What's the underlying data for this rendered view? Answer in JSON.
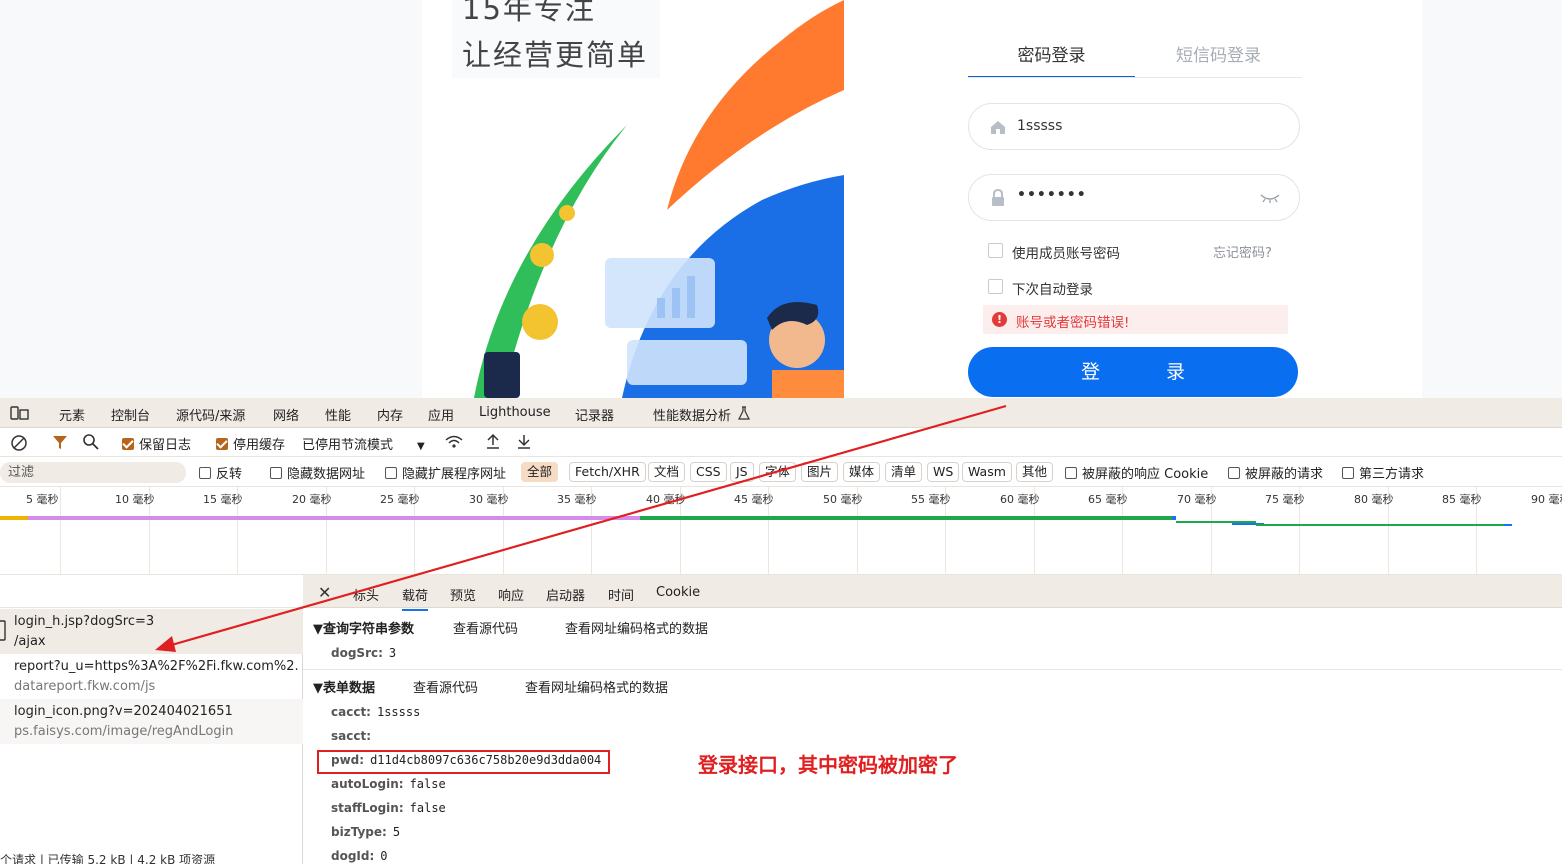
{
  "hero": {
    "line1": "15年专注",
    "line2": "让经营更简单"
  },
  "login": {
    "tabs": [
      "密码登录",
      "短信码登录"
    ],
    "username_value": "1sssss",
    "password_mask": "•••••••",
    "member_checkbox": "使用成员账号密码",
    "forgot": "忘记密码?",
    "auto_login": "下次自动登录",
    "error_icon": "!",
    "error": "账号或者密码错误!",
    "button": "登 录"
  },
  "devtools": {
    "tabs": [
      "元素",
      "控制台",
      "源代码/来源",
      "网络",
      "性能",
      "内存",
      "应用",
      "Lighthouse",
      "记录器",
      "性能数据分析"
    ],
    "toolbar": {
      "preserve_log": "保留日志",
      "disable_cache": "停用缓存",
      "throttle": "已停用节流模式"
    },
    "filter": {
      "placeholder": "过滤",
      "invert": "反转",
      "hide_data_urls": "隐藏数据网址",
      "hide_ext": "隐藏扩展程序网址",
      "chips": [
        "全部",
        "Fetch/XHR",
        "文档",
        "CSS",
        "JS",
        "字体",
        "图片",
        "媒体",
        "清单",
        "WS",
        "Wasm",
        "其他"
      ],
      "blocked_cookies": "被屏蔽的响应 Cookie",
      "blocked_requests": "被屏蔽的请求",
      "third_party": "第三方请求"
    },
    "timeline_ticks": [
      "5 毫秒",
      "10 毫秒",
      "15 毫秒",
      "20 毫秒",
      "25 毫秒",
      "30 毫秒",
      "35 毫秒",
      "40 毫秒",
      "45 毫秒",
      "50 毫秒",
      "55 毫秒",
      "60 毫秒",
      "65 毫秒",
      "70 毫秒",
      "75 毫秒",
      "80 毫秒",
      "85 毫秒",
      "90 毫秒"
    ],
    "requests": [
      {
        "name": "login_h.jsp?dogSrc=3",
        "sub": "/ajax"
      },
      {
        "name": "report?u_u=https%3A%2F%2Fi.fkw.com%2...",
        "sub": "datareport.fkw.com/js"
      },
      {
        "name": "login_icon.png?v=202404021651",
        "sub": "ps.faisys.com/image/regAndLogin"
      }
    ],
    "status_bar": "个请求 | 已传输 5.2 kB | 4.2 kB 项资源",
    "detail_tabs": [
      "标头",
      "载荷",
      "预览",
      "响应",
      "启动器",
      "时间",
      "Cookie"
    ],
    "query": {
      "title": "▼查询字符串参数",
      "view_source": "查看源代码",
      "view_url_encoded": "查看网址编码格式的数据",
      "params": [
        {
          "k": "dogSrc:",
          "v": "3"
        }
      ]
    },
    "form": {
      "title": "▼表单数据",
      "view_source": "查看源代码",
      "view_url_encoded": "查看网址编码格式的数据",
      "params": [
        {
          "k": "cacct:",
          "v": "1sssss"
        },
        {
          "k": "sacct:",
          "v": ""
        },
        {
          "k": "pwd:",
          "v": "d11d4cb8097c636c758b20e9d3dda004"
        },
        {
          "k": "autoLogin:",
          "v": "false"
        },
        {
          "k": "staffLogin:",
          "v": "false"
        },
        {
          "k": "bizType:",
          "v": "5"
        },
        {
          "k": "dogId:",
          "v": "0"
        }
      ]
    },
    "annotation": "登录接口，其中密码被加密了"
  },
  "colors": {
    "accent": "#0a6ef0",
    "error": "#e33b3b",
    "annotation_red": "#e02020",
    "devtools_bg": "#f1ebe5"
  }
}
